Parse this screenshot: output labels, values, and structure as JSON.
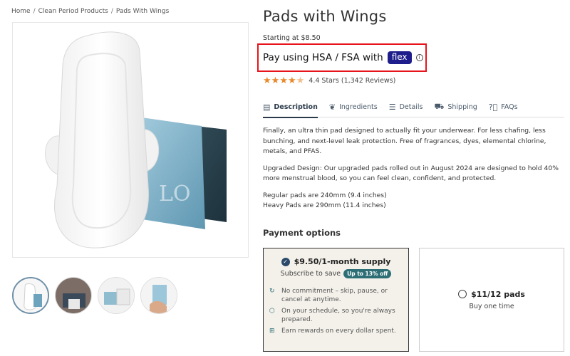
{
  "breadcrumb": {
    "items": [
      "Home",
      "Clean Period Products",
      "Pads With Wings"
    ],
    "separator": "/"
  },
  "product": {
    "title": "Pads with Wings",
    "starting_price": "Starting at $8.50",
    "hsa_text": "Pay using HSA / FSA with",
    "hsa_badge": "flex",
    "info_icon_glyph": "i",
    "rating_text": "4.4 Stars (1,342 Reviews)",
    "rating_value": 4.4,
    "rating_max": 5,
    "star_color": "#e8892c"
  },
  "tabs": [
    {
      "label": "Description",
      "icon": "document-icon"
    },
    {
      "label": "Ingredients",
      "icon": "leaf-icon"
    },
    {
      "label": "Details",
      "icon": "list-icon"
    },
    {
      "label": "Shipping",
      "icon": "truck-icon"
    },
    {
      "label": "FAQs",
      "icon": "question-circle-icon"
    }
  ],
  "description": {
    "p1": "Finally, an ultra thin pad designed to actually fit your underwear. For less chafing, less bunching, and next-level leak protection. Free of fragrances, dyes, elemental chlorine, metals, and PFAS.",
    "p2": "Upgraded Design: Our upgraded pads rolled out in August 2024 are designed to hold 40% more menstrual blood, so you can feel clean, confident, and protected.",
    "p3_line1": "Regular pads are 240mm (9.4 inches)",
    "p3_line2": "Heavy Pads are 290mm (11.4 inches)"
  },
  "payment": {
    "title": "Payment options",
    "subscription": {
      "label": "$9.50/1-month supply",
      "save_text": "Subscribe to save",
      "save_badge": "Up to 13% off",
      "benefits": [
        {
          "text": "No commitment – skip, pause, or cancel at anytime.",
          "icon": "refresh-icon"
        },
        {
          "text": "On your schedule, so you're always prepared.",
          "icon": "box-icon"
        },
        {
          "text": "Earn rewards on every dollar spent.",
          "icon": "gift-icon"
        }
      ]
    },
    "one_time": {
      "label": "$11/12 pads",
      "sub": "Buy one time"
    }
  },
  "colors": {
    "accent": "#2b4a6a",
    "highlight_border": "#e8141c",
    "flex_badge": "#1d1d8c",
    "save_badge": "#2e6f76"
  }
}
